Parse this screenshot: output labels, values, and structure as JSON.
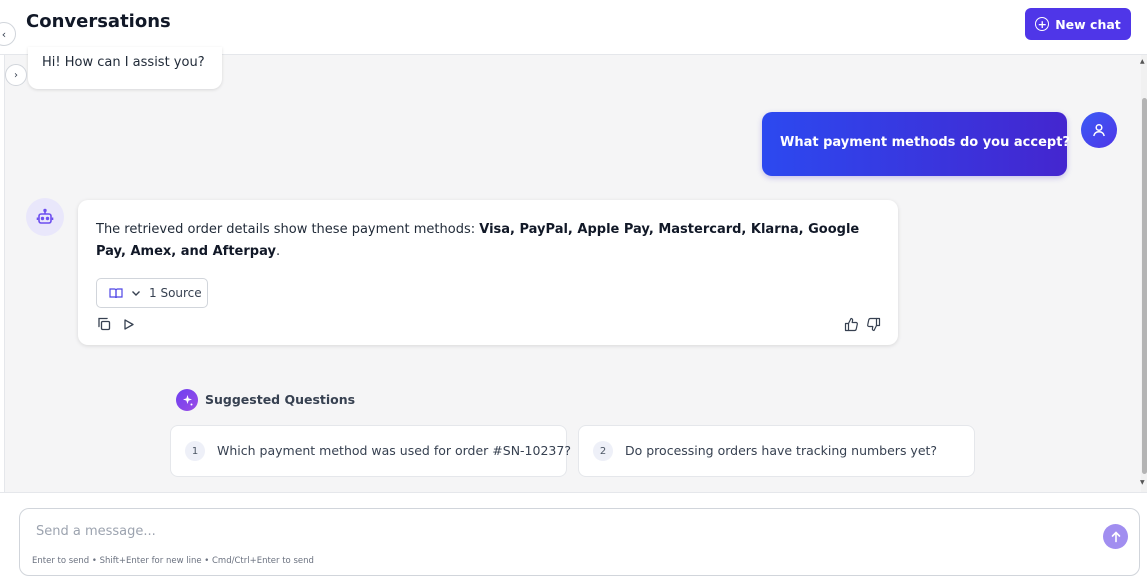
{
  "header": {
    "title": "Conversations",
    "new_chat_label": "New chat"
  },
  "messages": {
    "greeting": "Hi! How can I assist you?",
    "user_question": "What payment methods do you accept?",
    "bot_reply_prefix": "The retrieved order details show these payment methods: ",
    "bot_reply_methods": "Visa, PayPal, Apple Pay, Mastercard, Klarna, Google Pay, Amex, and Afterpay",
    "bot_reply_suffix": ".",
    "source_label": "1 Source"
  },
  "suggested": {
    "title": "Suggested Questions",
    "items": [
      {
        "num": "1",
        "text": "Which payment method was used for order #SN-10237?"
      },
      {
        "num": "2",
        "text": "Do processing orders have tracking numbers yet?"
      }
    ]
  },
  "composer": {
    "placeholder": "Send a message...",
    "hint": "Enter to send • Shift+Enter for new line • Cmd/Ctrl+Enter to send"
  },
  "colors": {
    "accent": "#4f36e8",
    "user_bubble_start": "#2c49f0",
    "user_bubble_end": "#4426cf",
    "send_button": "#a18ef0"
  },
  "icons": {
    "collapse": "chevron-left-icon",
    "expand": "chevron-right-icon",
    "new_chat": "plus-circle-icon",
    "user": "user-icon",
    "bot": "bot-icon",
    "source": "book-open-icon",
    "copy": "copy-icon",
    "play": "play-icon",
    "like": "thumbs-up-icon",
    "dislike": "thumbs-down-icon",
    "sparkle": "sparkle-icon",
    "send": "arrow-up-icon"
  }
}
